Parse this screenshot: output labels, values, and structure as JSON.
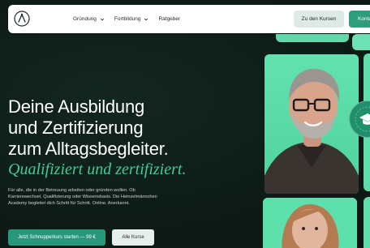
{
  "header": {
    "nav": [
      {
        "label": "Gründung"
      },
      {
        "label": "Fortbildung"
      },
      {
        "label": "Ratgeber"
      }
    ],
    "btn_courses": "Zu den Kursen",
    "btn_contact": "Kontakt"
  },
  "hero": {
    "title_lines": [
      "Deine Ausbildung",
      "und Zertifizierung",
      "zum Alltagsbegleiter."
    ],
    "subtitle": "Qualifiziert und zertifiziert.",
    "description": "Für alle, die in der Betreuung arbeiten oder gründen wollen. Ob Karrierewechsel, Qualifizierung oder Wissensbasis. Die Heinzelmännchen Academy begleitet dich Schritt für Schritt. Online. Anerkannt.",
    "cta_primary": "Jetzt Schnupperkurs starten — 99 €",
    "cta_secondary": "Alle Kurse"
  },
  "colors": {
    "background": "#0e1d18",
    "accent": "#3fcf98",
    "primary_button": "#26997a",
    "image_bg": "#5be0a9"
  }
}
